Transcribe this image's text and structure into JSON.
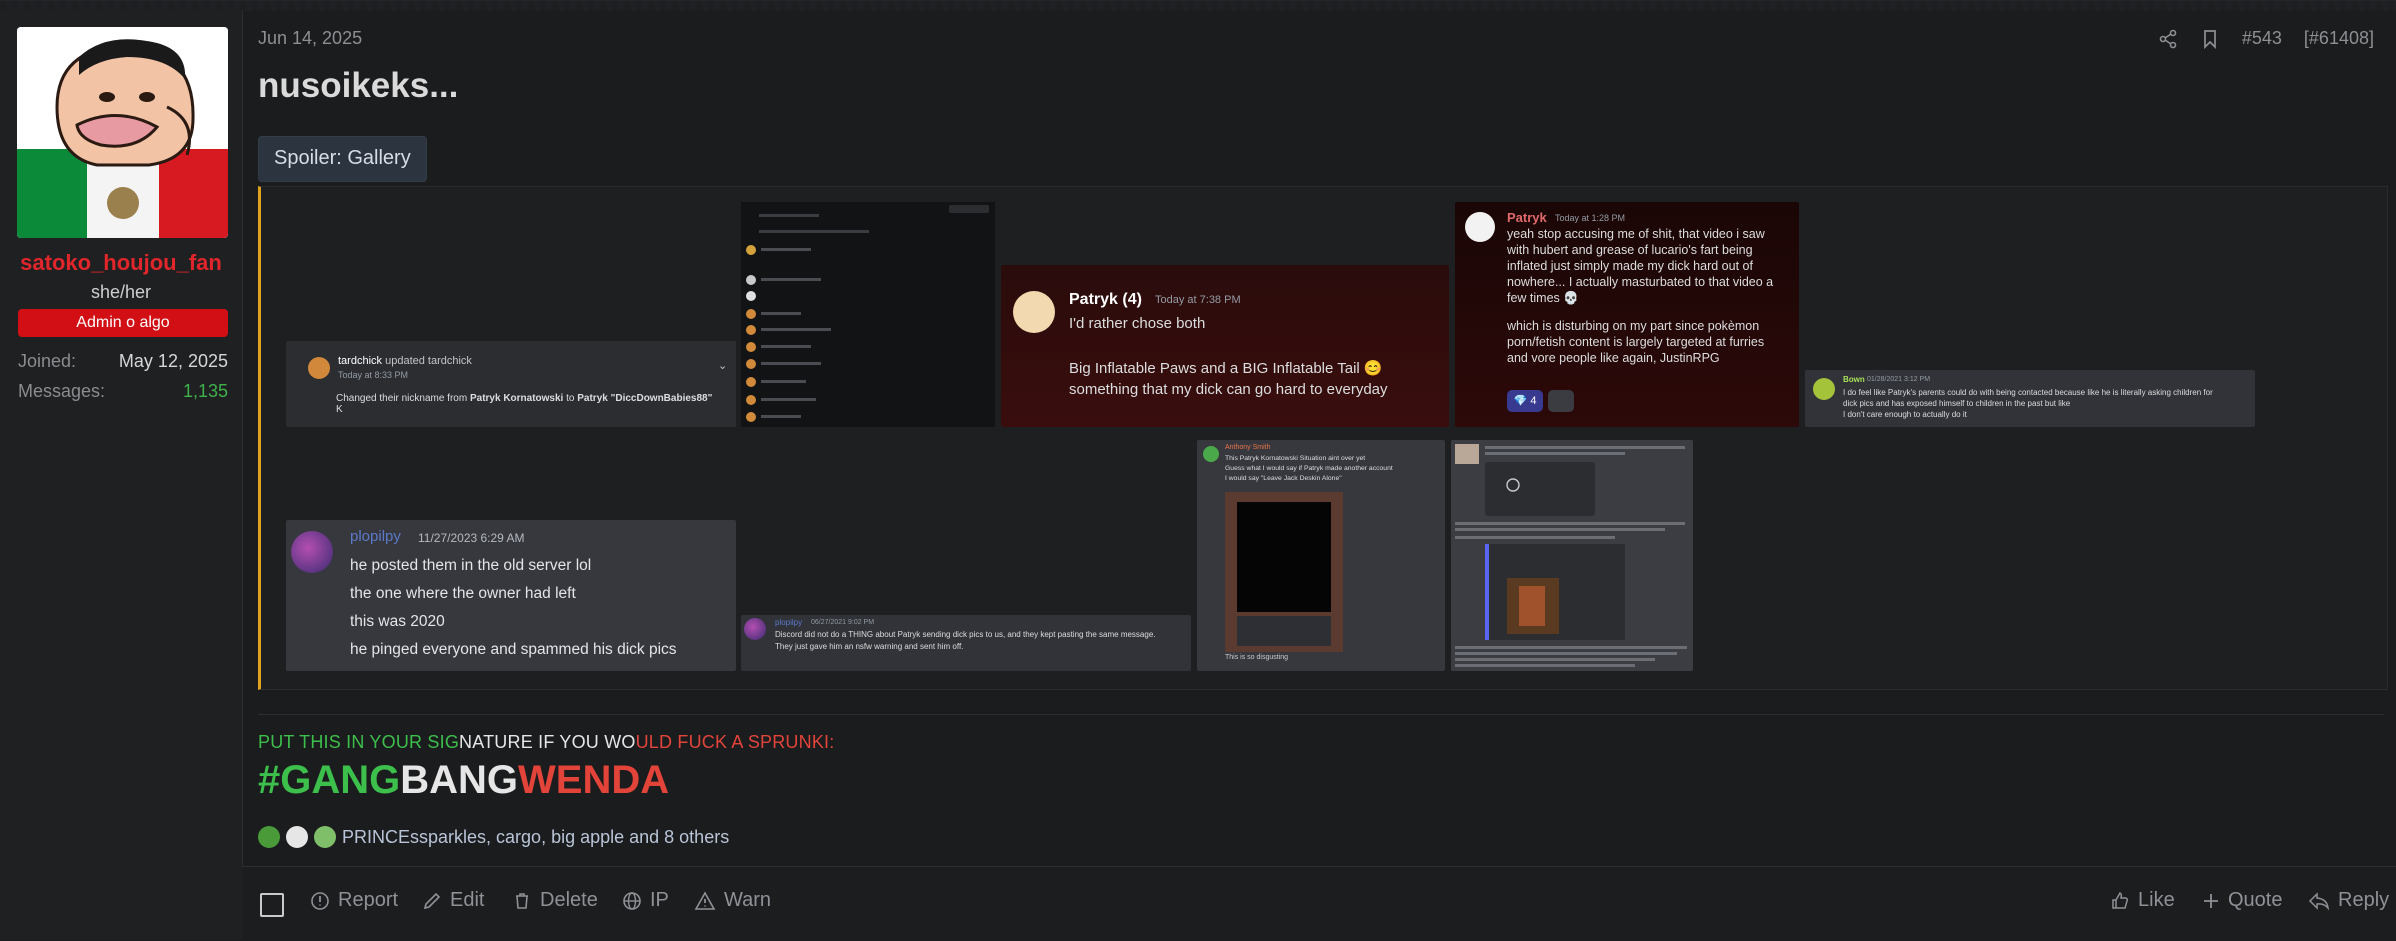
{
  "sidebar": {
    "username": "satoko_houjou_fan",
    "pronouns": "she/her",
    "role_badge": "Admin o algo",
    "joined_label": "Joined:",
    "joined_value": "May 12, 2025",
    "messages_label": "Messages:",
    "messages_value": "1,135"
  },
  "post": {
    "date": "Jun 14, 2025",
    "number": "#543",
    "post_id": "[#61408]",
    "title": "nusoikeks...",
    "spoiler_label": "Spoiler: Gallery"
  },
  "gallery": {
    "t1": {
      "user": "tardchick",
      "action": "updated tardchick",
      "time": "Today at 8:33 PM",
      "line1": "Changed their nickname from",
      "from": "Patryk Kornatowski",
      "to_word": "to",
      "to": "Patryk \"DiccDownBabies88\"",
      "tail": "K"
    },
    "t3": {
      "user": "Patryk (4)",
      "time": "Today at 7:38 PM",
      "line1": "I'd rather chose both",
      "line2": "Big Inflatable Paws and a BIG Inflatable Tail 😊",
      "line3": "something that my dick can go hard to everyday"
    },
    "t4": {
      "user": "Patryk",
      "time": "Today at 1:28 PM",
      "line1": "yeah stop accusing me of shit, that video i saw",
      "line2": "with hubert and grease of lucario's fart being",
      "line3": "inflated just simply made my dick hard out of",
      "line4": "nowhere... I actually masturbated to that video a",
      "line5": "few times 💀",
      "line6": "which is disturbing on my part since pokèmon",
      "line7": "porn/fetish content is largely targeted at furries",
      "line8": "and vore people like again, JustinRPG",
      "reaction": "4"
    },
    "t5": {
      "user": "Bown",
      "time": "01/28/2021 3:12 PM",
      "line1": "I do feel like Patryk's parents could do with being contacted because like he is literally asking children for",
      "line2": "dick pics and has exposed himself to children in the past but like",
      "line3": "I don't care enough to actually do it"
    },
    "t6": {
      "user": "plopilpy",
      "time": "11/27/2023 6:29 AM",
      "line1": "he posted them in the old server lol",
      "line2": "the one where the owner had left",
      "line3": "this was 2020",
      "line4": "he pinged everyone and spammed his dick pics"
    },
    "t7": {
      "user": "plopilpy",
      "time": "06/27/2021 9:02 PM",
      "line1": "Discord did not do a THING about Patryk sending dick pics to us, and they kept pasting the same message.",
      "line2": "They just gave him an nsfw warning and sent him off."
    },
    "t8": {
      "user": "Anthony Smith",
      "line1": "This Patryk Kornatowski Situation aint over yet",
      "line2": "Guess what I would say if Patryk made another account",
      "line3": "I would say \"Leave Jack Deskin Alone\"",
      "footer": "This is so disgusting"
    }
  },
  "signature": {
    "line_green1": "PUT THIS IN YOUR SIG",
    "line_white": "NATURE IF YOU WO",
    "line_red": "ULD FUCK A SPRUNKI:",
    "big_green": "#GANG",
    "big_white": "BANG",
    "big_red": "WENDA"
  },
  "reactions": {
    "text": "PRINCEssparkles, cargo, big apple and 8 others"
  },
  "footer": {
    "report": "Report",
    "edit": "Edit",
    "delete": "Delete",
    "ip": "IP",
    "warn": "Warn",
    "like": "Like",
    "quote": "Quote",
    "reply": "Reply"
  },
  "colors": {
    "admin_red": "#d10f14",
    "username_red": "#e0262b",
    "messages_green": "#3fb24a",
    "spoiler_border": "#e0a21d",
    "sig_green": "#3cbf4b",
    "sig_red": "#e2443a"
  }
}
